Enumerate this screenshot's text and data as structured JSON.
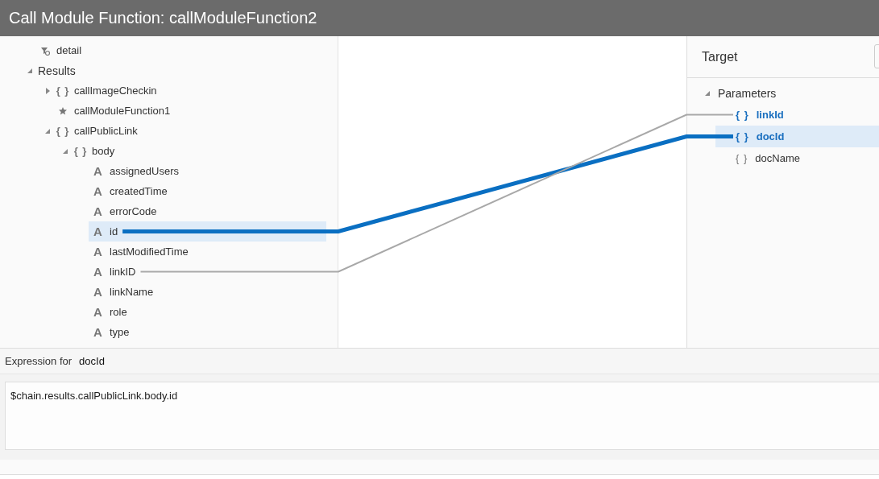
{
  "window": {
    "title": "Call Module Function: callModuleFunction2"
  },
  "source_tree": [
    {
      "label": "detail",
      "kind": "filter",
      "selected": false
    },
    {
      "label": "Results",
      "expanded": true,
      "selected": false,
      "children": [
        {
          "label": "callImageCheckin",
          "kind": "object",
          "glyph": "{ }",
          "expanded": false,
          "selected": false
        },
        {
          "label": "callModuleFunction1",
          "kind": "any",
          "selected": false
        },
        {
          "label": "callPublicLink",
          "kind": "object",
          "glyph": "{ }",
          "expanded": true,
          "selected": false,
          "children": [
            {
              "label": "body",
              "kind": "object",
              "glyph": "{ }",
              "expanded": true,
              "selected": false,
              "children": [
                {
                  "label": "assignedUsers",
                  "kind": "string",
                  "glyph": "A",
                  "selected": false
                },
                {
                  "label": "createdTime",
                  "kind": "string",
                  "glyph": "A",
                  "selected": false
                },
                {
                  "label": "errorCode",
                  "kind": "string",
                  "glyph": "A",
                  "selected": false
                },
                {
                  "label": "id",
                  "kind": "string",
                  "glyph": "A",
                  "selected": true,
                  "mapped": true
                },
                {
                  "label": "lastModifiedTime",
                  "kind": "string",
                  "glyph": "A",
                  "selected": false
                },
                {
                  "label": "linkID",
                  "kind": "string",
                  "glyph": "A",
                  "selected": false,
                  "mapped": true
                },
                {
                  "label": "linkName",
                  "kind": "string",
                  "glyph": "A",
                  "selected": false
                },
                {
                  "label": "role",
                  "kind": "string",
                  "glyph": "A",
                  "selected": false
                },
                {
                  "label": "type",
                  "kind": "string",
                  "glyph": "A",
                  "selected": false
                }
              ]
            }
          ]
        }
      ]
    }
  ],
  "target": {
    "title": "Target",
    "group": {
      "label": "Parameters",
      "expanded": true
    },
    "params": [
      {
        "label": "linkId",
        "glyph": "{ }",
        "mapped": true,
        "selected": false
      },
      {
        "label": "docId",
        "glyph": "{ }",
        "mapped": true,
        "selected": true
      },
      {
        "label": "docName",
        "glyph": "{ }",
        "mapped": false,
        "selected": false
      }
    ]
  },
  "expression": {
    "label": "Expression for",
    "name": "docId",
    "value": "$chain.results.callPublicLink.body.id"
  }
}
